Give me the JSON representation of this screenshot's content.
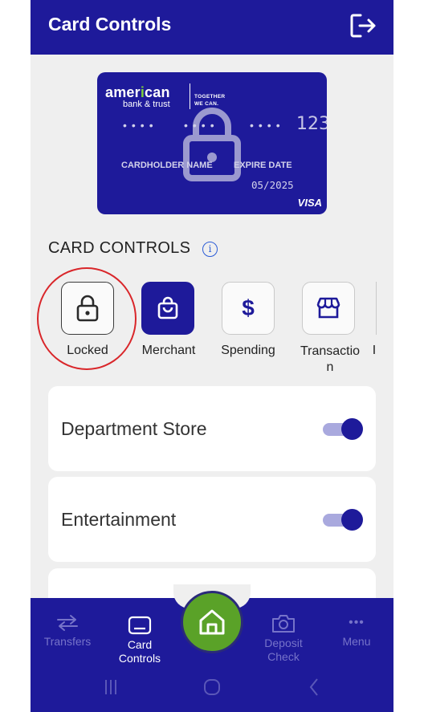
{
  "header": {
    "title": "Card Controls",
    "logout_icon": "logout-icon"
  },
  "card": {
    "brand_name_start": "amer",
    "brand_name_i": "i",
    "brand_name_end": "can",
    "brand_sub": "bank & trust",
    "brand_tag_line1": "TOGETHER",
    "brand_tag_line2": "WE CAN.",
    "dots_1": "••••",
    "dots_2": "••••",
    "dots_3": "••••",
    "last_digits": "123",
    "holder_label": "CARDHOLDER NAME",
    "expire_label": "EXPIRE DATE",
    "expire_value": "05/2025",
    "network": "VISA",
    "status_icon": "lock-icon"
  },
  "section": {
    "title": "CARD CONTROLS",
    "info_icon": "info-icon"
  },
  "controls": [
    {
      "label": "Locked",
      "icon": "lock-icon"
    },
    {
      "label": "Merchant",
      "icon": "shopping-bag-icon"
    },
    {
      "label": "Spending",
      "icon": "dollar-icon",
      "glyph": "$"
    },
    {
      "label": "Transactio\nn",
      "icon": "store-icon"
    }
  ],
  "categories": [
    {
      "label": "Department Store",
      "enabled": true
    },
    {
      "label": "Entertainment",
      "enabled": true
    }
  ],
  "nav": {
    "transfers": "Transfers",
    "card_controls_line1": "Card",
    "card_controls_line2": "Controls",
    "deposit_line1": "Deposit",
    "deposit_line2": "Check",
    "menu": "Menu",
    "menu_glyph": "•••"
  },
  "colors": {
    "brand": "#1e1a9a",
    "accent": "#5aa228",
    "highlight": "#d9262a"
  }
}
